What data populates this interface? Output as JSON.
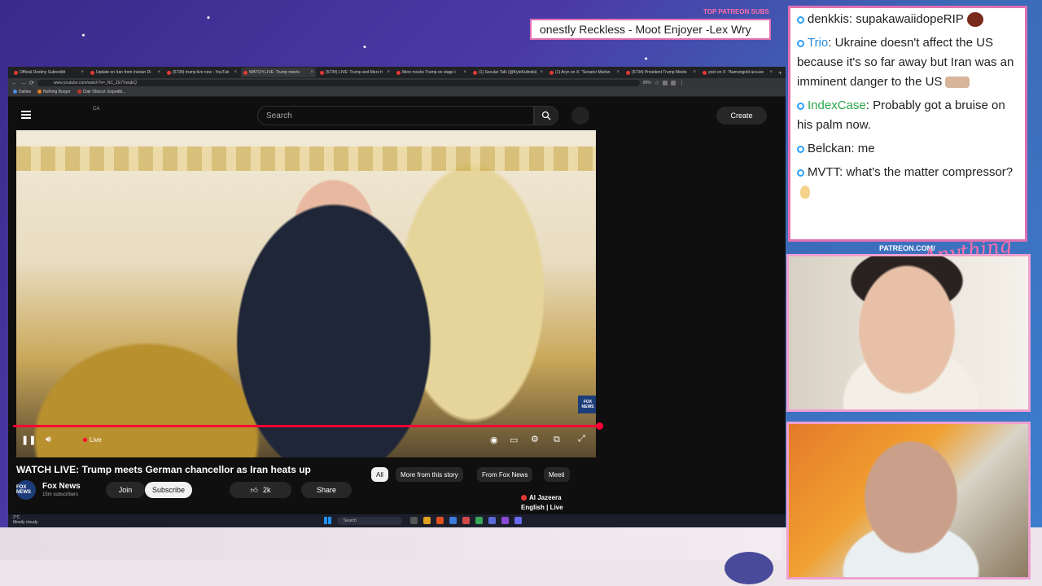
{
  "overlay": {
    "patreon_label": "TOP PATREON SUBS",
    "patreon_ticker": "onestly Reckless - Moot Enjoyer -Lex Wry",
    "patreon_url": "PATREON.COM/",
    "script_logo": "Anything Else?"
  },
  "chat": [
    {
      "user": "denkkis",
      "user_color": "#222222",
      "text": "supakawaiidopeRIP",
      "emote": "ball"
    },
    {
      "user": "Trio",
      "user_color": "#2a8ad8",
      "text": "Ukraine doesn't affect the US because it's so far away but Iran was an imminent danger to the US",
      "emote": "arms"
    },
    {
      "user": "IndexCase",
      "user_color": "#2aa84a",
      "text": "Probably got a bruise on his palm now.",
      "emote": ""
    },
    {
      "user": "Belckan",
      "user_color": "#222222",
      "text": "me",
      "emote": ""
    },
    {
      "user": "MVTT",
      "user_color": "#222222",
      "text": "what's the matter compressor?",
      "emote": "drop"
    }
  ],
  "browser": {
    "tabs": [
      {
        "label": "Official Destiny Subreddit",
        "active": false
      },
      {
        "label": "Update on Iran from Iranian Di",
        "active": false
      },
      {
        "label": "(5734) trump live now - YouTub",
        "active": false
      },
      {
        "label": "WATCH LIVE: Trump meets",
        "active": true
      },
      {
        "label": "(5734) LIVE: Trump and Merz h",
        "active": false
      },
      {
        "label": "Merz mocks Trump on stage i",
        "active": false
      },
      {
        "label": "(1) Secular Talk (@KyleKulinski)",
        "active": false
      },
      {
        "label": "(1) Aryn on X: \"Senator Markw",
        "active": false
      },
      {
        "label": "(5734) President Trump Meets",
        "active": false
      },
      {
        "label": "yeet on X: \"Aamongold accuse",
        "active": false
      }
    ],
    "url": "www.youtube.com/watch?v=_NC_ZE7VwqEQ",
    "zoom": "80%",
    "bookmarks": [
      "Dailies",
      "Nothing Burger",
      "Clair Obscur: Expediti..."
    ]
  },
  "youtube": {
    "country": "CA",
    "search_placeholder": "Search",
    "create_label": "Create",
    "live_label": "Live",
    "fox_bug": "FOX NEWS",
    "title": "WATCH LIVE: Trump meets German chancellor as Iran heats up",
    "channel_logo": "FOX NEWS",
    "channel_name": "Fox News",
    "subscribers": "15m subscribers",
    "join_label": "Join",
    "subscribe_label": "Subscribe",
    "likes": "2k",
    "share_label": "Share",
    "chips": [
      "All",
      "More from this story",
      "From Fox News",
      "Meeti"
    ],
    "rec_channel": "Al Jazeera",
    "rec_sub": "English | Live"
  },
  "taskbar": {
    "weather_temp": "2°C",
    "weather_desc": "Mostly cloudy",
    "search": "Search"
  }
}
